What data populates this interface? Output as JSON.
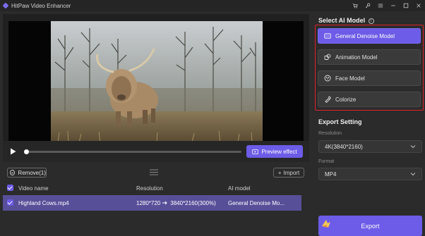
{
  "app": {
    "title": "HitPaw Video Enhancer"
  },
  "titlebar": {
    "icons": [
      "cart-icon",
      "key-icon",
      "menu-icon",
      "minimize-icon",
      "maximize-icon",
      "close-icon"
    ]
  },
  "player": {
    "preview_label": "Preview effect",
    "progress": 0.0
  },
  "list_toolbar": {
    "remove_label": "Remove(1)",
    "import_label": "Import"
  },
  "table": {
    "headers": {
      "name": "Video name",
      "resolution": "Resolution",
      "ai_model": "AI model"
    },
    "rows": [
      {
        "name": "Highland Cows.mp4",
        "resolution_from": "1280*720",
        "resolution_to": "3840*2160(300%)",
        "ai_model": "General Denoise Mo..."
      }
    ]
  },
  "right_panel": {
    "select_model_title": "Select AI Model",
    "models": [
      {
        "label": "General Denoise Model",
        "icon": "denoise-icon",
        "active": true
      },
      {
        "label": "Animation Model",
        "icon": "animation-icon",
        "active": false
      },
      {
        "label": "Face Model",
        "icon": "face-icon",
        "active": false
      },
      {
        "label": "Colorize",
        "icon": "colorize-icon",
        "active": false
      }
    ],
    "export_setting_title": "Export Setting",
    "resolution_label": "Resolution",
    "resolution_value": "4K(3840*2160)",
    "format_label": "Format",
    "format_value": "MP4",
    "export_label": "Export"
  },
  "colors": {
    "accent": "#6c5ce7",
    "highlight_border": "#e0222a",
    "background": "#2b2b2b"
  }
}
